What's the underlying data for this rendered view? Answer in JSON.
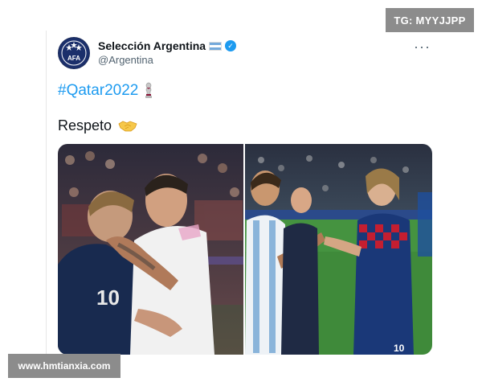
{
  "badge": {
    "text": "TG: MYYJJPP"
  },
  "tweet": {
    "display_name": "Selección Argentina",
    "handle": "@Argentina",
    "more_label": "···",
    "hashtag": "#Qatar2022",
    "text": "Respeto",
    "avatar_label": "AFA",
    "icons": {
      "avatar": "afa-crest-icon",
      "flag": "argentina-flag-icon",
      "verified": "verified-badge-icon",
      "more": "more-options-icon",
      "trophy": "world-cup-trophy-icon",
      "handshake": "handshake-emoji-icon"
    }
  },
  "watermark": {
    "text": "www.hmtianxia.com"
  },
  "colors": {
    "link": "#1d9bf0",
    "text": "#0f1419",
    "muted": "#536471",
    "overlay": "#8c8c8c"
  }
}
